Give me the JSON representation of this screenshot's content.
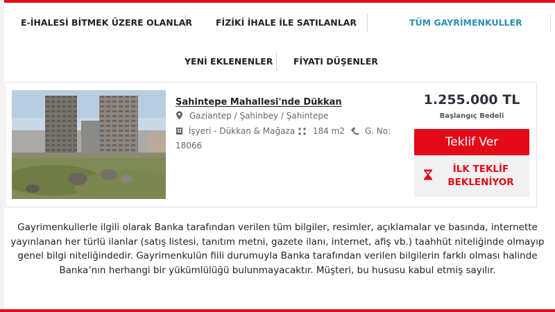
{
  "tabs": {
    "ending_eauction": "E-İHALESİ BİTMEK ÜZERE OLANLAR",
    "physical_auction": "FİZİKİ İHALE İLE SATILANLAR",
    "all_properties": "TÜM GAYRİMENKULLER",
    "newly_added": "YENİ EKLENENLER",
    "price_dropped": "FİYATI DÜŞENLER"
  },
  "listing": {
    "title": "Şahintepe Mahallesi'nde Dükkan",
    "location": "Gaziantep / Şahinbey / Şahintepe",
    "type": "İşyeri - Dükkan & Mağaza",
    "area": "184 m2",
    "no_label": "G. No:",
    "no_value": "18066",
    "price": "1.255.000 TL",
    "price_label": "Başlangıç Bedeli",
    "bid_button": "Teklif Ver",
    "first_bid_line1": "İLK TEKLİF",
    "first_bid_line2": "BEKLENİYOR"
  },
  "disclaimer": "Gayrimenkullerle ilgili olarak Banka tarafından verilen tüm bilgiler, resimler, açıklamalar ve basında, internette yayınlanan her türlü ilanlar (satış listesi, tanıtım metni, gazete ilanı, internet, afiş vb.) taahhüt niteliğinde olmayıp genel bilgi niteliğindedir. Gayrimenkulün fiili durumuyla Banka tarafından verilen bilgilerin farklı olması halinde Banka’nın herhangi bir yükümlülüğü bulunmayacaktır. Müşteri, bu hususu kabul etmiş sayılır.",
  "colors": {
    "accent_red": "#e30a17",
    "active_tab": "#2b8fb8",
    "price_text": "#2a3140"
  },
  "icons": {
    "location": "map-pin-icon",
    "type": "building-icon",
    "area": "area-arrows-icon",
    "number": "hammer-icon",
    "status": "hourglass-icon"
  }
}
